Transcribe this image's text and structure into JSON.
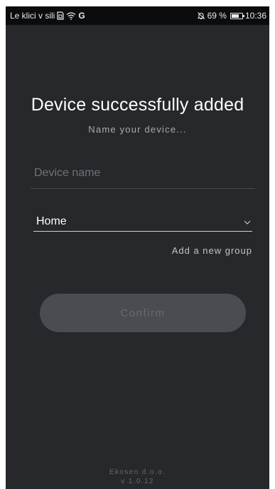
{
  "status_bar": {
    "carrier": "Le klici v sili",
    "battery_percent": "69 %",
    "battery_level": 0.69,
    "time": "10:36",
    "google_letter": "G",
    "icons": [
      "sim-icon",
      "wifi-icon",
      "google-icon",
      "mute-icon",
      "battery-icon"
    ]
  },
  "screen": {
    "title": "Device successfully added",
    "subtitle": "Name your device...",
    "device_name": {
      "value": "",
      "placeholder": "Device name"
    },
    "group_select": {
      "selected": "Home"
    },
    "add_group_label": "Add a new group",
    "confirm_label": "Confirm"
  },
  "footer": {
    "company": "Ekosen d.o.o.",
    "version": "v 1.0.12"
  },
  "colors": {
    "background": "#26282b",
    "status_bar": "#0b0c0d",
    "button_disabled": "#494c50"
  }
}
